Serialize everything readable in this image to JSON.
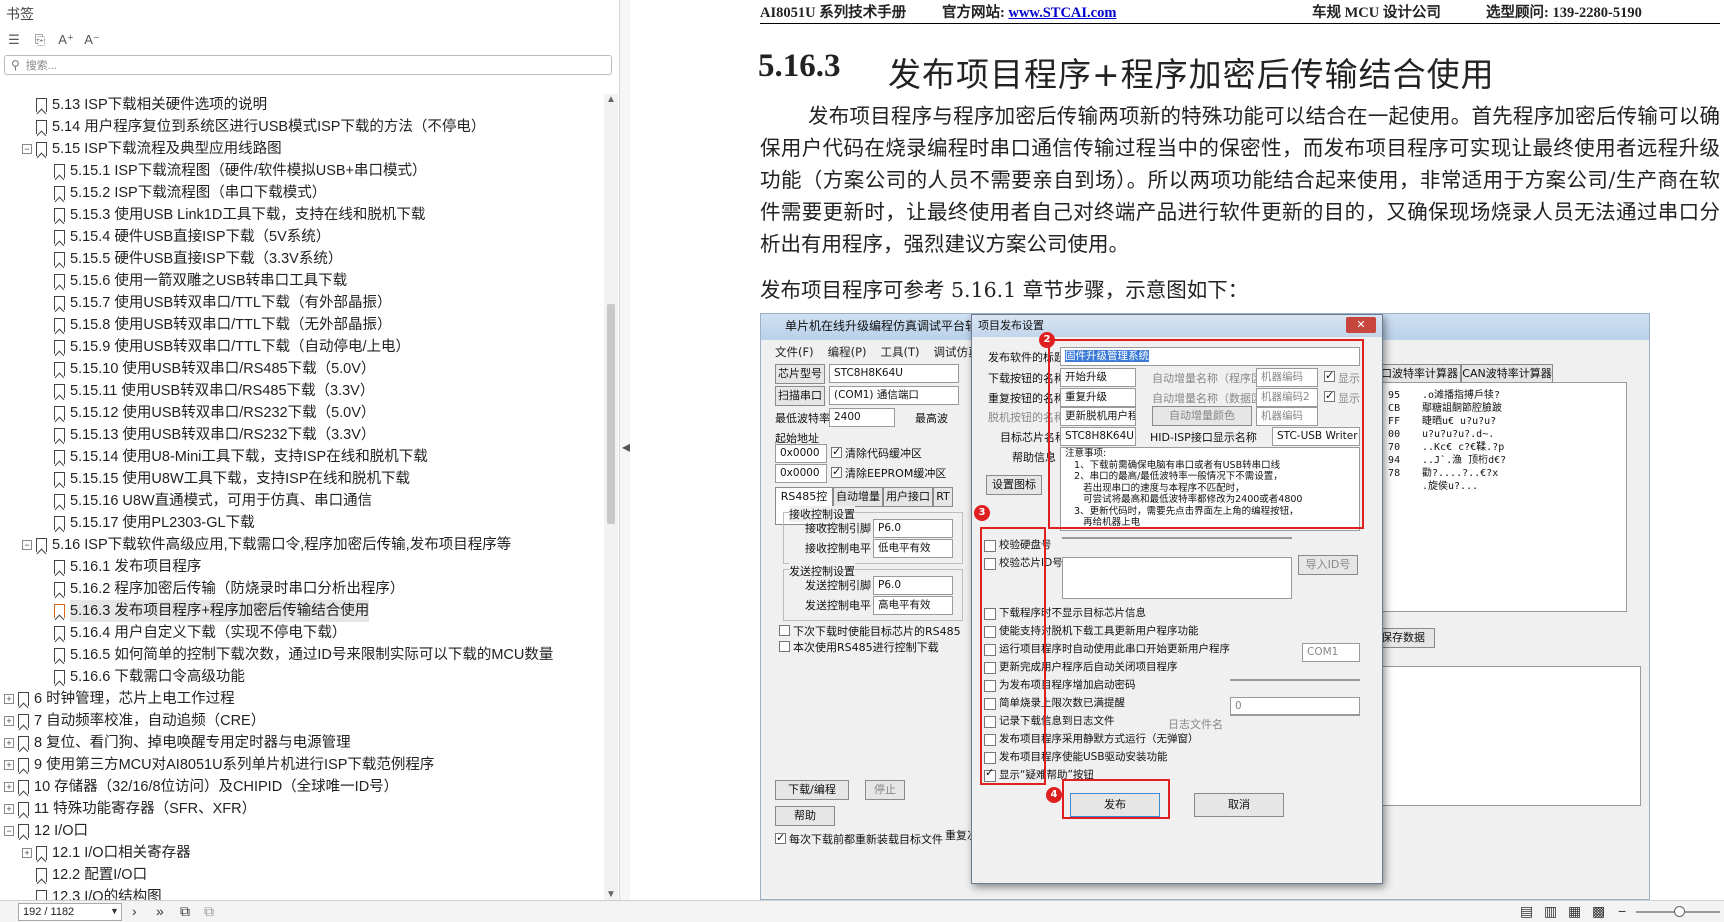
{
  "bookmarks": {
    "panel_title": "书签",
    "search_placeholder": "搜索...",
    "tree": [
      {
        "level": 1,
        "toggle": "",
        "label": "5.13  ISP下载相关硬件选项的说明"
      },
      {
        "level": 1,
        "toggle": "",
        "label": "5.14  用户程序复位到系统区进行USB模式ISP下载的方法（不停电）"
      },
      {
        "level": 1,
        "toggle": "−",
        "label": "5.15  ISP下载流程及典型应用线路图"
      },
      {
        "level": 2,
        "toggle": "",
        "label": "5.15.1 ISP下载流程图（硬件/软件模拟USB+串口模式）"
      },
      {
        "level": 2,
        "toggle": "",
        "label": "5.15.2  ISP下载流程图（串口下载模式）"
      },
      {
        "level": 2,
        "toggle": "",
        "label": "5.15.3  使用USB Link1D工具下载，支持在线和脱机下载"
      },
      {
        "level": 2,
        "toggle": "",
        "label": "5.15.4  硬件USB直接ISP下载（5V系统）"
      },
      {
        "level": 2,
        "toggle": "",
        "label": "5.15.5  硬件USB直接ISP下载（3.3V系统）"
      },
      {
        "level": 2,
        "toggle": "",
        "label": "5.15.6  使用一箭双雕之USB转串口工具下载"
      },
      {
        "level": 2,
        "toggle": "",
        "label": "5.15.7  使用USB转双串口/TTL下载（有外部晶振）"
      },
      {
        "level": 2,
        "toggle": "",
        "label": "5.15.8  使用USB转双串口/TTL下载（无外部晶振）"
      },
      {
        "level": 2,
        "toggle": "",
        "label": "5.15.9  使用USB转双串口/TTL下载（自动停电/上电）"
      },
      {
        "level": 2,
        "toggle": "",
        "label": "5.15.10  使用USB转双串口/RS485下载（5.0V）"
      },
      {
        "level": 2,
        "toggle": "",
        "label": "5.15.11 使用USB转双串口/RS485下载（3.3V）"
      },
      {
        "level": 2,
        "toggle": "",
        "label": "5.15.12  使用USB转双串口/RS232下载（5.0V）"
      },
      {
        "level": 2,
        "toggle": "",
        "label": "5.15.13 使用USB转双串口/RS232下载（3.3V）"
      },
      {
        "level": 2,
        "toggle": "",
        "label": "5.15.14  使用U8-Mini工具下载，支持ISP在线和脱机下载"
      },
      {
        "level": 2,
        "toggle": "",
        "label": "5.15.15  使用U8W工具下载，支持ISP在线和脱机下载"
      },
      {
        "level": 2,
        "toggle": "",
        "label": "5.15.16  U8W直通模式，可用于仿真、串口通信"
      },
      {
        "level": 2,
        "toggle": "",
        "label": "5.15.17  使用PL2303-GL下载"
      },
      {
        "level": 1,
        "toggle": "−",
        "label": "5.16  ISP下载软件高级应用,下载需口令,程序加密后传输,发布项目程序等"
      },
      {
        "level": 2,
        "toggle": "",
        "label": "5.16.1  发布项目程序"
      },
      {
        "level": 2,
        "toggle": "",
        "label": "5.16.2  程序加密后传输（防烧录时串口分析出程序）"
      },
      {
        "level": 2,
        "toggle": "",
        "label": "5.16.3  发布项目程序+程序加密后传输结合使用",
        "selected": true
      },
      {
        "level": 2,
        "toggle": "",
        "label": "5.16.4  用户自定义下载（实现不停电下载）"
      },
      {
        "level": 2,
        "toggle": "",
        "label": "5.16.5  如何简单的控制下载次数，通过ID号来限制实际可以下载的MCU数量"
      },
      {
        "level": 2,
        "toggle": "",
        "label": "5.16.6  下载需口令高级功能"
      },
      {
        "level": 0,
        "toggle": "+",
        "label": "6  时钟管理，芯片上电工作过程"
      },
      {
        "level": 0,
        "toggle": "+",
        "label": "7  自动频率校准，自动追频（CRE）"
      },
      {
        "level": 0,
        "toggle": "+",
        "label": "8  复位、看门狗、掉电唤醒专用定时器与电源管理"
      },
      {
        "level": 0,
        "toggle": "+",
        "label": "9  使用第三方MCU对AI8051U系列单片机进行ISP下载范例程序"
      },
      {
        "level": 0,
        "toggle": "+",
        "label": "10  存储器（32/16/8位访问）及CHIPID（全球唯一ID号）"
      },
      {
        "level": 0,
        "toggle": "+",
        "label": "11  特殊功能寄存器（SFR、XFR）"
      },
      {
        "level": 0,
        "toggle": "−",
        "label": "12  I/O口"
      },
      {
        "level": 1,
        "toggle": "+",
        "label": "12.1 I/O口相关寄存器"
      },
      {
        "level": 1,
        "toggle": "",
        "label": "12.2  配置I/O口"
      },
      {
        "level": 1,
        "toggle": "",
        "label": "12.3  I/O的结构图"
      }
    ]
  },
  "document": {
    "header_left": "AI8051U 系列技术手册",
    "header_site_label": "官方网站: ",
    "header_site_url": "www.STCAI.com",
    "header_center": "车规 MCU 设计公司",
    "header_right": "选型顾问: 139-2280-5190",
    "section_number": "5.16.3",
    "section_title": "发布项目程序+程序加密后传输结合使用",
    "paragraph1": "发布项目程序与程序加密后传输两项新的特殊功能可以结合在一起使用。首先程序加密后传输可以确保用户代码在烧录编程时串口通信传输过程当中的保密性，而发布项目程序可实现让最终使用者远程升级功能（方案公司的人员不需要亲自到场）。所以两项功能结合起来使用，非常适用于方案公司/生产商在软件需要更新时，让最终使用者自己对终端产品进行软件更新的目的，又确保现场烧录人员无法通过串口分析出有用程序，强烈建议方案公司使用。",
    "paragraph2": "发布项目程序可参考 5.16.1 章节步骤，示意图如下："
  },
  "figure": {
    "main_window_title": "单片机在线升级编程仿真调试平台软",
    "menu": [
      "文件(F)",
      "编程(P)",
      "工具(T)",
      "调试仿真"
    ],
    "chip_label": "芯片型号",
    "chip_value": "STC8H8K64U",
    "scan_label": "扫描串口",
    "port_value": "(COM1) 通信端口",
    "baud_label": "最低波特率",
    "baud_value": "2400",
    "max_baud_label": "最高波",
    "start_addr_label": "起始地址",
    "addr1": "0x0000",
    "clear_code": "清除代码缓冲区",
    "addr2": "0x0000",
    "clear_eeprom": "清除EEPROM缓冲区",
    "tabs": [
      "RS485控制",
      "自动增量",
      "用户接口",
      "RT"
    ],
    "rx_group": "接收控制设置",
    "rx_pin_label": "接收控制引脚",
    "rx_pin_value": "P6.0",
    "rx_level_label": "接收控制电平",
    "rx_level_value": "低电平有效",
    "tx_group": "发送控制设置",
    "tx_pin_label": "发送控制引脚",
    "tx_pin_value": "P6.0",
    "tx_level_label": "发送控制电平",
    "tx_level_value": "高电平有效",
    "opt1": "下次下载时使能目标芯片的RS485",
    "opt2": "本次使用RS485进行控制下载",
    "download_btn": "下载/编程",
    "stop_btn": "停止",
    "help_btn": "帮助",
    "bottom_check": "每次下载前都重新装载目标文件",
    "repeat_label": "重复次数",
    "repeat_value": "2 次",
    "right_tabs": [
      "串口波特率计算器",
      "CAN波特率计算器"
    ],
    "hex_rows": [
      "F5  95",
      "F5  CB",
      "B0  FF",
      "7E  00",
      "06  70",
      "80  94",
      "22  78"
    ],
    "ascii_rows": [
      ".o滩播指搏戶犊?",
      "鄢糖詛酮節腔臉跛",
      "睫晒u€  u?u?u?",
      "u?u?u?u?.d~.",
      "..Kc€  c?€鞣.?p",
      "..J`.渔  顶桁d€?",
      "勸?....?..€?x",
      ".旋侯u?..."
    ],
    "save_data_btn": "保存数据",
    "dialog": {
      "title": "项目发布设置",
      "close": "✕",
      "publish_title_label": "发布软件的标题",
      "publish_title_value": "固件升级管理系统",
      "download_btn_label": "下载按钮的名称",
      "download_btn_value": "开始升级",
      "repeat_btn_label": "重复按钮的名称",
      "repeat_btn_value": "重复升级",
      "offline_btn_label": "脱机按钮的名称",
      "offline_btn_value": "更新脱机用户程",
      "target_chip_label": "目标芯片名称",
      "target_chip_value": "STC8H8K64U",
      "hid_label": "HID-ISP接口显示名称",
      "hid_value": "STC-USB Writer",
      "help_label": "帮助信息",
      "help_text": "注意事项:\n   1、下载前需确保电脑有串口或者有USB转串口线\n   2、串口的最高/最低波特率一般情况下不需设置，\n      若出现串口的速度与本程序不匹配时，\n      可尝试将最高和最低波特率都修改为2400或者4800\n   3、更新代码时，需要先点击界面左上角的编程按钮，\n      再给机器上电",
      "auto_inc_prog": "自动增量名称（程序区）",
      "machine_code1": "机器编码",
      "show1": "显示",
      "auto_inc_data": "自动增量名称（数据区）",
      "machine_code2": "机器编码2",
      "show2": "显示",
      "auto_inc_color": "自动增量颜色",
      "machine_code3": "机器编码",
      "set_icon_btn": "设置图标",
      "import_id_btn": "导入ID号",
      "com_value": "COM1",
      "count_value": "0",
      "log_label": "日志文件名",
      "checks": [
        {
          "label": "校验硬盘号",
          "on": false
        },
        {
          "label": "校验芯片ID号",
          "on": false
        },
        {
          "label": "下载程序时不显示目标芯片信息",
          "on": false
        },
        {
          "label": "使能支持对脱机下载工具更新用户程序功能",
          "on": false
        },
        {
          "label": "运行项目程序时自动使用此串口开始更新用户程序",
          "on": false
        },
        {
          "label": "更新完成用户程序后自动关闭项目程序",
          "on": false
        },
        {
          "label": "为发布项目程序增加启动密码",
          "on": false
        },
        {
          "label": "简单烧录上限次数已满提醒",
          "on": false
        },
        {
          "label": "记录下载信息到日志文件",
          "on": false
        },
        {
          "label": "发布项目程序采用静默方式运行（无弹窗）",
          "on": false
        },
        {
          "label": "发布项目程序使能USB驱动安装功能",
          "on": false
        },
        {
          "label": "显示“疑难帮助”按钮",
          "on": true
        }
      ],
      "publish_btn": "发布",
      "cancel_btn": "取消",
      "badges": [
        "2",
        "3",
        "4"
      ]
    }
  },
  "statusbar": {
    "page_value": "192 / 1182"
  }
}
